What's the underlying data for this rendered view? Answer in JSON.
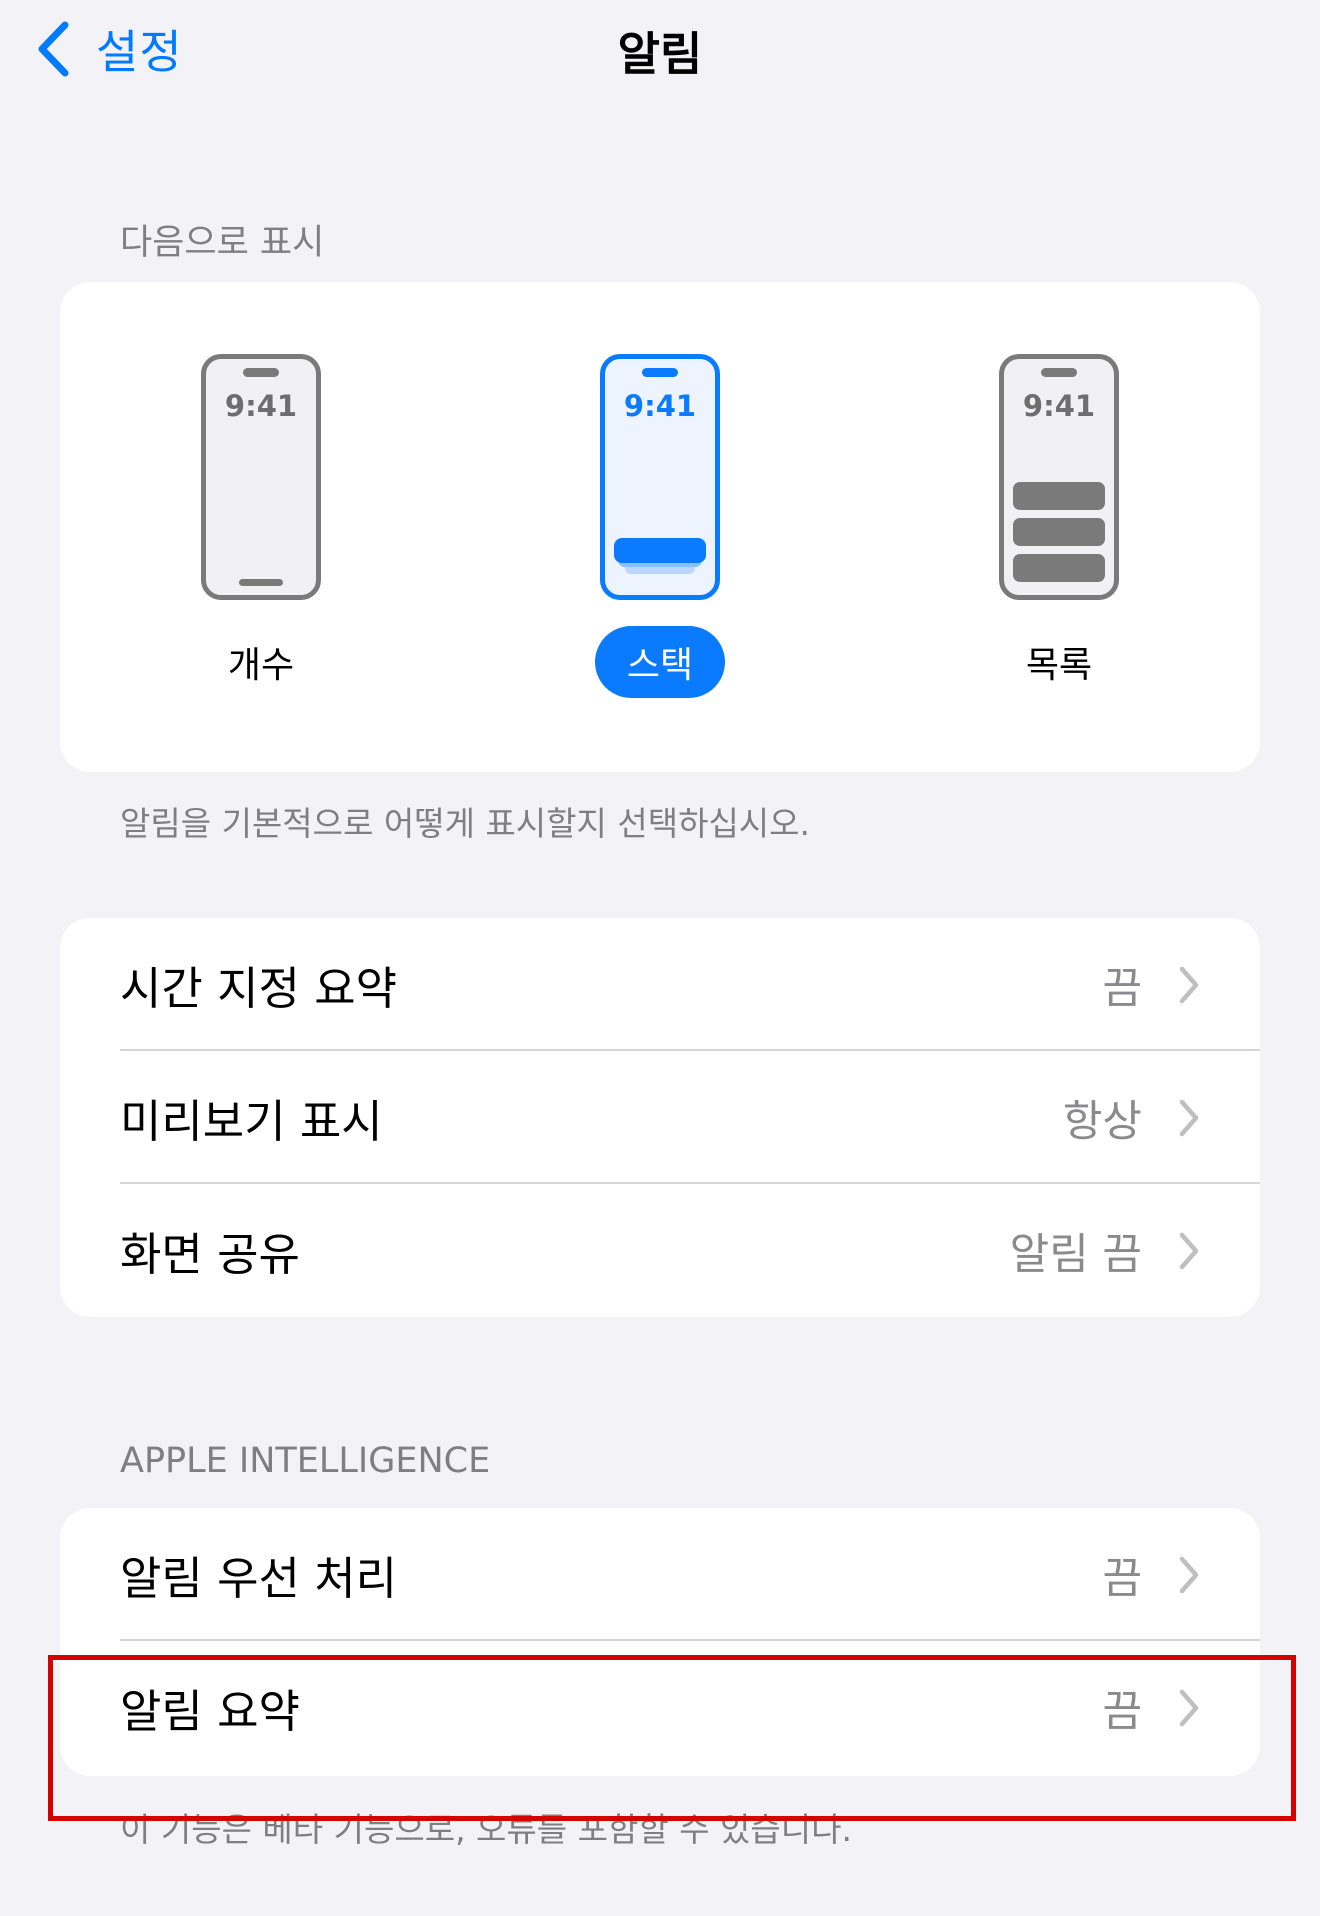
{
  "nav": {
    "back_label": "설정",
    "title": "알림"
  },
  "display_section": {
    "header": "다음으로 표시",
    "footer": "알림을 기본적으로 어떻게 표시할지 선택하십시오.",
    "options": [
      {
        "label": "개수",
        "clock": "9:41",
        "selected": false
      },
      {
        "label": "스택",
        "clock": "9:41",
        "selected": true
      },
      {
        "label": "목록",
        "clock": "9:41",
        "selected": false
      }
    ]
  },
  "general_group": {
    "rows": [
      {
        "label": "시간 지정 요약",
        "value": "끔"
      },
      {
        "label": "미리보기 표시",
        "value": "항상"
      },
      {
        "label": "화면 공유",
        "value": "알림 끔"
      }
    ]
  },
  "apple_intelligence": {
    "header": "APPLE INTELLIGENCE",
    "rows": [
      {
        "label": "알림 우선 처리",
        "value": "끔"
      },
      {
        "label": "알림 요약",
        "value": "끔"
      }
    ],
    "footer": "이 기능은 베타 기능으로, 오류를 포함할 수 있습니다."
  },
  "colors": {
    "accent": "#0A7AFF",
    "background": "#F2F2F7",
    "highlight_box": "#D50000"
  }
}
